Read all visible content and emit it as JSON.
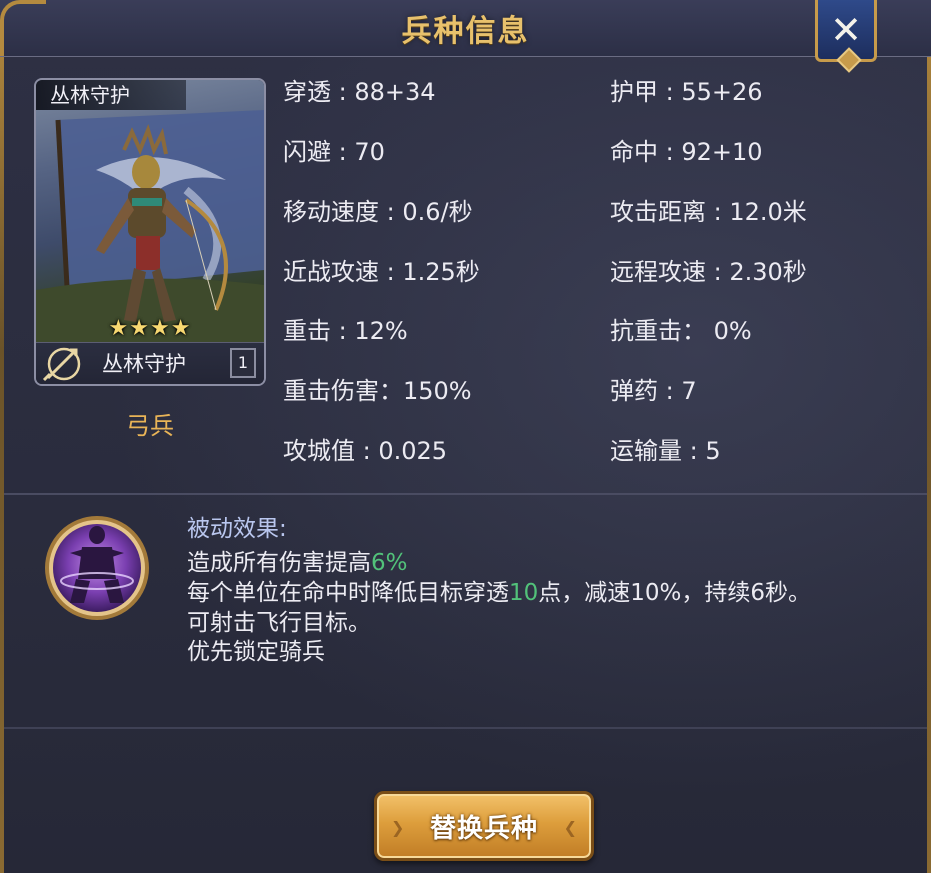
{
  "header": {
    "title": "兵种信息",
    "close_icon": "close-icon"
  },
  "unit": {
    "name_top": "丛林守护",
    "name_bottom": "丛林守护",
    "stars": "★★★★",
    "star_count": 4,
    "level": "1",
    "class_icon": "archer-bow-icon",
    "type": "弓兵"
  },
  "stats": {
    "left": [
      "穿透 : 88+34",
      "闪避 : 70",
      "移动速度 : 0.6/秒",
      "近战攻速 : 1.25秒",
      "重击 : 12%",
      "重击伤害：150%",
      "攻城值 : 0.025"
    ],
    "right": [
      "护甲 : 55+26",
      "命中 : 92+10",
      "攻击距离 : 12.0米",
      "远程攻速 : 2.30秒",
      "抗重击：  0%",
      "弹药 : 7",
      "运输量 : 5"
    ]
  },
  "passive": {
    "icon": "passive-skill-icon",
    "title": "被动效果:",
    "line1_pre": "造成所有伤害提高",
    "line1_hl": "6%",
    "line2_pre": "每个单位在命中时降低目标穿透",
    "line2_hl": "10",
    "line2_post": "点，减速10%，持续6秒。",
    "line3": "可射击飞行目标。",
    "line4": "优先锁定骑兵"
  },
  "footer": {
    "replace_label": "替换兵种"
  },
  "colors": {
    "title": "#e8c16c",
    "unit_type": "#e9b457",
    "highlight": "#52c27a",
    "passive_title": "#b9c6ee",
    "button": "#dd9e3c"
  }
}
